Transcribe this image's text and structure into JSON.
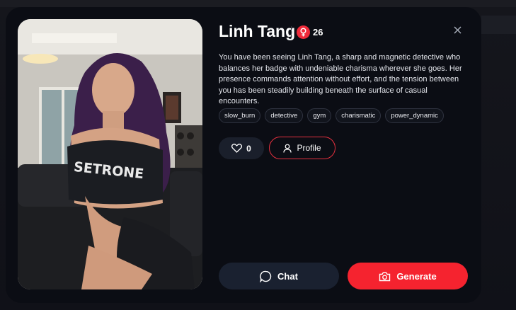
{
  "character": {
    "name": "Linh Tang",
    "age": "26",
    "gender_icon": "female-icon",
    "description": "You have been seeing Linh Tang, a sharp and magnetic detective who balances her badge with undeniable charisma wherever she goes. Her presence commands attention without effort, and the tension between you has been steadily building beneath the surface of casual encounters.",
    "photo_shirt_text": "SETRONE",
    "tags": [
      "slow_burn",
      "detective",
      "gym",
      "charismatic",
      "power_dynamic"
    ]
  },
  "actions": {
    "like_count": "0",
    "profile_label": "Profile",
    "chat_label": "Chat",
    "generate_label": "Generate"
  },
  "icons": {
    "close": "close-icon",
    "like": "heart-icon",
    "profile": "user-icon",
    "chat": "chat-bubble-icon",
    "generate": "camera-icon"
  },
  "colors": {
    "accent": "#f5232f",
    "badge": "#f02a3a",
    "modal_bg": "#0b0d14",
    "secondary_button": "#1a2130"
  }
}
